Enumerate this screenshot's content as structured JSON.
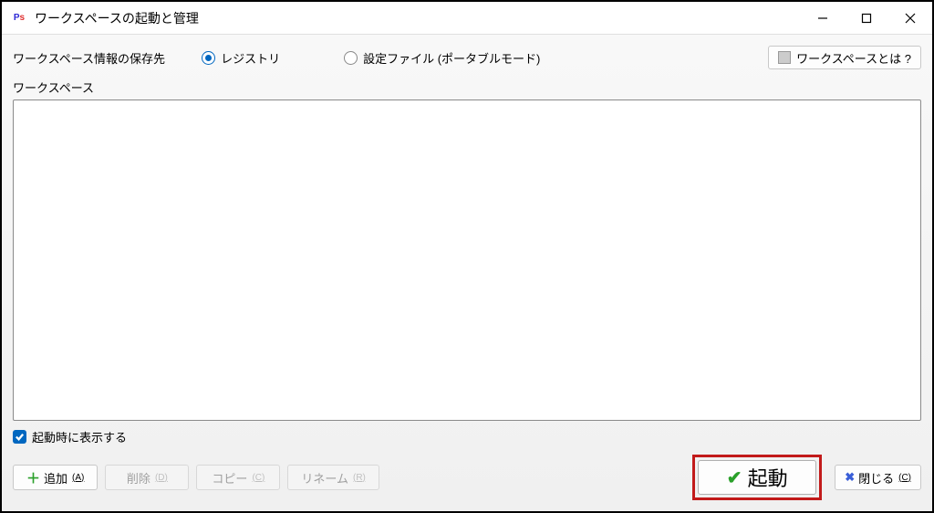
{
  "titlebar": {
    "title": "ワークスペースの起動と管理"
  },
  "topRow": {
    "label": "ワークスペース情報の保存先",
    "radioRegistry": "レジストリ",
    "radioFile": "設定ファイル (ポータブルモード)",
    "helpButton": "ワークスペースとは ?"
  },
  "list": {
    "label": "ワークスペース"
  },
  "checkbox": {
    "label": "起動時に表示する"
  },
  "buttons": {
    "add": "追加",
    "addKey": "(A)",
    "delete": "削除",
    "deleteKey": "(D)",
    "copy": "コピー",
    "copyKey": "(C)",
    "rename": "リネーム",
    "renameKey": "(R)",
    "launch": "起動",
    "close": "閉じる",
    "closeKey": "(C)"
  }
}
